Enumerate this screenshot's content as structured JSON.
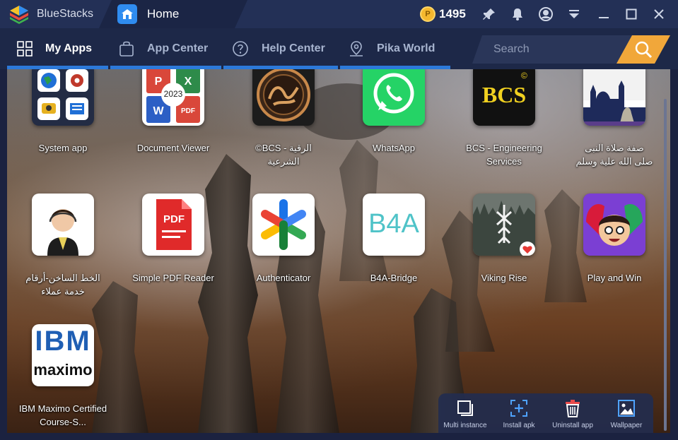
{
  "titlebar": {
    "app_name": "BlueStacks",
    "tab_title": "Home",
    "coin_symbol": "P",
    "coins": "1495",
    "icons": [
      "bluestacks-logo-icon",
      "home-icon",
      "coin-icon",
      "pin-tool-icon",
      "bell-icon",
      "account-icon",
      "dropdown-menu-icon",
      "minimize-icon",
      "maximize-icon",
      "close-icon"
    ]
  },
  "nav": {
    "tabs": [
      {
        "label": "My Apps",
        "icon": "grid-icon",
        "active": true
      },
      {
        "label": "App Center",
        "icon": "shopping-bag-icon",
        "active": false
      },
      {
        "label": "Help Center",
        "icon": "help-circle-icon",
        "active": false
      },
      {
        "label": "Pika World",
        "icon": "map-pin-icon",
        "active": false
      }
    ],
    "search_placeholder": "Search"
  },
  "apps": {
    "row1": [
      {
        "label": "System app",
        "icon": "system-app-icon"
      },
      {
        "label": "Document Viewer",
        "icon": "document-viewer-icon",
        "badge": "2023"
      },
      {
        "label": "الرقية  - BCS©\nالشرعية",
        "icon": "ruqya-app-icon"
      },
      {
        "label": "WhatsApp",
        "icon": "whatsapp-icon"
      },
      {
        "label": "BCS - Engineering Services",
        "icon": "bcs-engineering-icon",
        "logo_text": "BCS"
      },
      {
        "label": "صفة صلاة النبى\nصلى الله علية وسلم",
        "icon": "prayer-app-icon"
      }
    ],
    "row2": [
      {
        "label": "الخط الساخن-أرقام\nخدمة عملاء",
        "icon": "hotline-app-icon"
      },
      {
        "label": "Simple PDF Reader",
        "icon": "pdf-reader-icon",
        "logo_text": "PDF"
      },
      {
        "label": "Authenticator",
        "icon": "authenticator-icon"
      },
      {
        "label": "B4A-Bridge",
        "icon": "b4a-bridge-icon",
        "logo_text": "B4A"
      },
      {
        "label": "Viking Rise",
        "icon": "viking-rise-icon"
      },
      {
        "label": "Play and Win",
        "icon": "play-and-win-icon"
      }
    ],
    "row3": [
      {
        "label": "IBM Maximo Certified Course-S...",
        "icon": "ibm-maximo-icon",
        "logo_text": "IBM",
        "logo_sub": "maximo"
      }
    ]
  },
  "toolbar": {
    "items": [
      {
        "label": "Multi instance",
        "icon": "multi-instance-icon"
      },
      {
        "label": "Install apk",
        "icon": "install-apk-icon"
      },
      {
        "label": "Uninstall app",
        "icon": "uninstall-app-icon"
      },
      {
        "label": "Wallpaper",
        "icon": "wallpaper-icon"
      }
    ]
  },
  "colors": {
    "titlebar": "#233056",
    "navbar": "#1d2848",
    "accent_blue": "#2c79d9",
    "search_button": "#f1a73a",
    "coin": "#f5b82e",
    "whatsapp_green": "#25d366"
  }
}
